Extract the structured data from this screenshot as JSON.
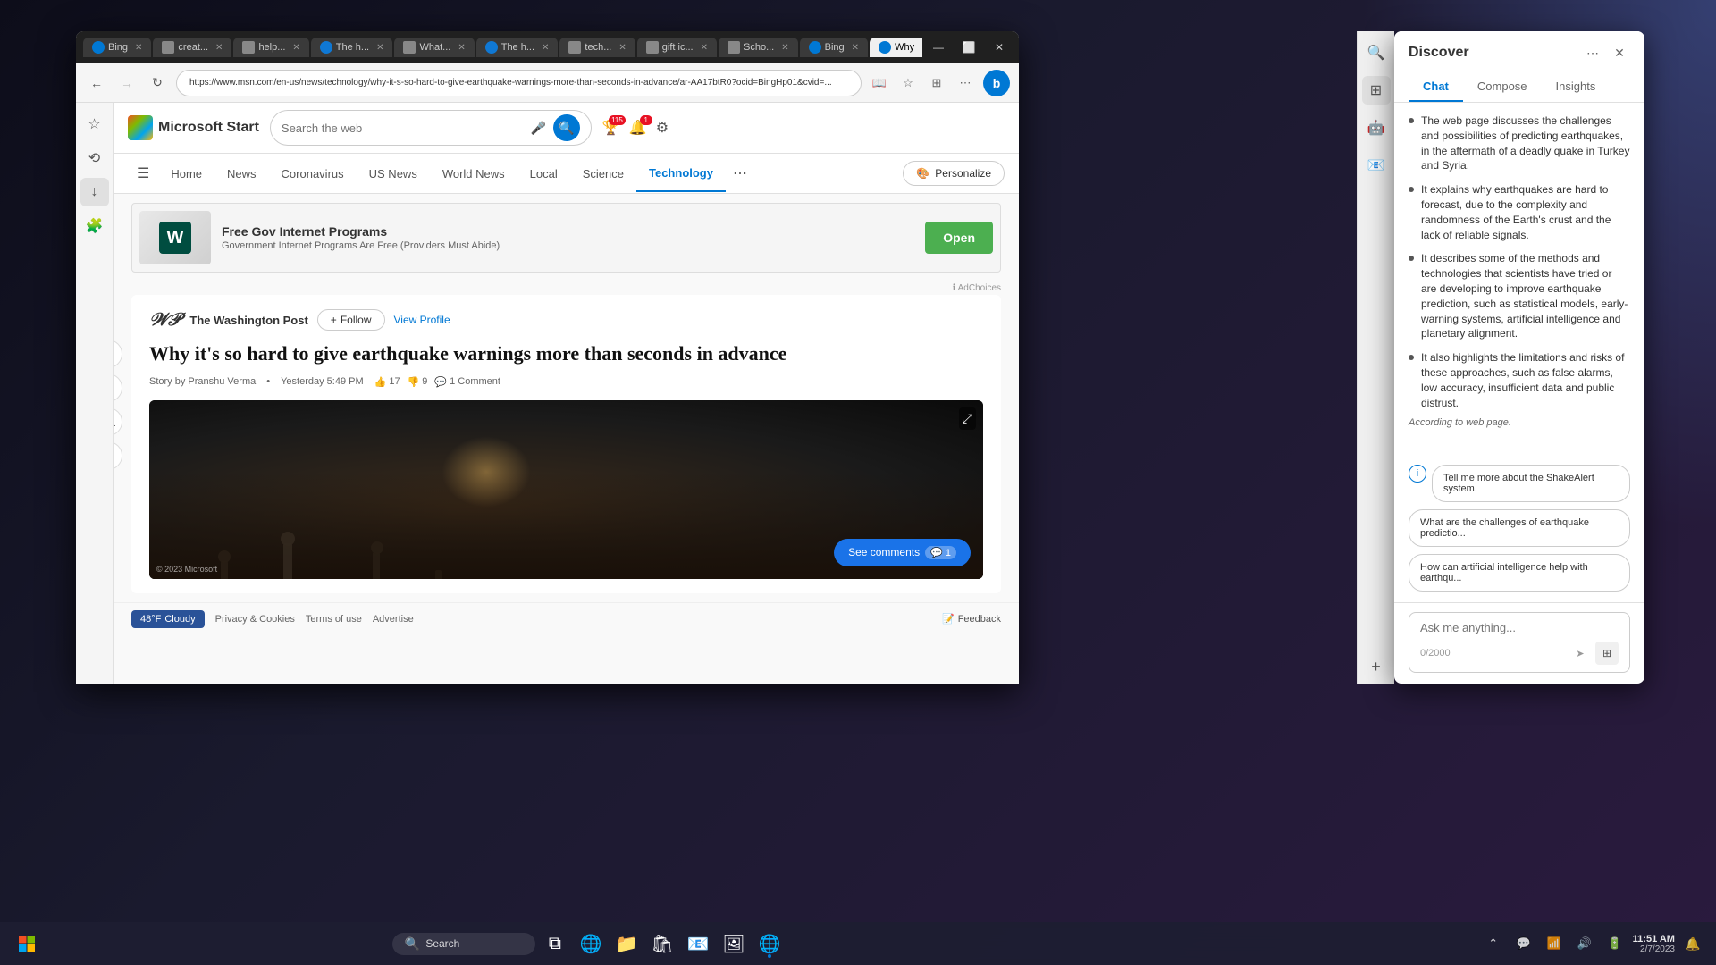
{
  "monitor": {
    "bg_color": "#1a1a2e"
  },
  "browser": {
    "tabs": [
      {
        "id": "bing1",
        "label": "Bing",
        "icon": "bing",
        "active": false
      },
      {
        "id": "create",
        "label": "creat...",
        "icon": "generic",
        "active": false
      },
      {
        "id": "help",
        "label": "help...",
        "icon": "generic",
        "active": false
      },
      {
        "id": "the1",
        "label": "The h...",
        "icon": "edge",
        "active": false
      },
      {
        "id": "what",
        "label": "What...",
        "icon": "generic",
        "active": false
      },
      {
        "id": "the2",
        "label": "The h...",
        "icon": "edge",
        "active": false
      },
      {
        "id": "tech",
        "label": "tech...",
        "icon": "generic",
        "active": false
      },
      {
        "id": "gift",
        "label": "gift ic...",
        "icon": "generic",
        "active": false
      },
      {
        "id": "scho",
        "label": "Scho...",
        "icon": "generic",
        "active": false
      },
      {
        "id": "bing2",
        "label": "Bing",
        "icon": "bing",
        "active": false
      },
      {
        "id": "why",
        "label": "Why",
        "icon": "bing",
        "active": true
      }
    ],
    "url": "https://www.msn.com/en-us/news/technology/why-it-s-so-hard-to-give-earthquake-warnings-more-than-seconds-in-advance/ar-AA17btR0?ocid=BingHp01&cvid=..."
  },
  "msn": {
    "logo_text": "Microsoft Start",
    "search_placeholder": "Search the web",
    "notifications_count": "1",
    "nav_items": [
      "Home",
      "News",
      "Coronavirus",
      "US News",
      "World News",
      "Local",
      "Science",
      "Technology"
    ],
    "active_nav": "Technology",
    "personalize_label": "Personalize",
    "ad": {
      "title": "Free Gov Internet Programs",
      "description": "Government Internet Programs Are Free (Providers Must Abide)",
      "open_label": "Open",
      "ad_choices": "AdChoices"
    },
    "article": {
      "source": "The Washington Post",
      "follow_label": "Follow",
      "view_profile_label": "View Profile",
      "title": "Why it's so hard to give earthquake warnings more than seconds in advance",
      "author": "Story by Pranshu Verma",
      "date": "Yesterday 5:49 PM",
      "likes": "17",
      "dislikes": "9",
      "comments": "1 Comment",
      "copyright": "© 2023 Microsoft",
      "see_comments_label": "See comments",
      "comments_count": "1"
    },
    "footer": {
      "privacy": "Privacy & Cookies",
      "terms": "Terms of use",
      "advertise": "Advertise",
      "feedback": "Feedback"
    },
    "weather": {
      "temp": "48°F",
      "condition": "Cloudy"
    }
  },
  "discover": {
    "title": "Discover",
    "tabs": [
      "Chat",
      "Compose",
      "Insights"
    ],
    "active_tab": "Chat",
    "bullets": [
      "The web page discusses the challenges and possibilities of predicting earthquakes, in the aftermath of a deadly quake in Turkey and Syria.",
      "It explains why earthquakes are hard to forecast, due to the complexity and randomness of the Earth's crust and the lack of reliable signals.",
      "It describes some of the methods and technologies that scientists have tried or are developing to improve earthquake prediction, such as statistical models, early-warning systems, artificial intelligence and planetary alignment.",
      "It also highlights the limitations and risks of these approaches, such as false alarms, low accuracy, insufficient data and public distrust."
    ],
    "according_text": "According to web page.",
    "suggestions": [
      "Tell me more about the ShakeAlert system.",
      "What are the challenges of earthquake predictio...",
      "How can artificial intelligence help with earthqu..."
    ],
    "ask_placeholder": "Ask me anything...",
    "char_count": "0/2000"
  },
  "taskbar": {
    "search_text": "Search",
    "clock_time": "11:51 AM",
    "clock_date": "2/7/2023",
    "taskbar_icons": [
      "start",
      "search",
      "task-view",
      "edge",
      "file-explorer",
      "store",
      "outlook",
      "photos",
      "edge-active"
    ],
    "system_tray": [
      "chevron",
      "chat",
      "network",
      "volume",
      "battery"
    ]
  }
}
